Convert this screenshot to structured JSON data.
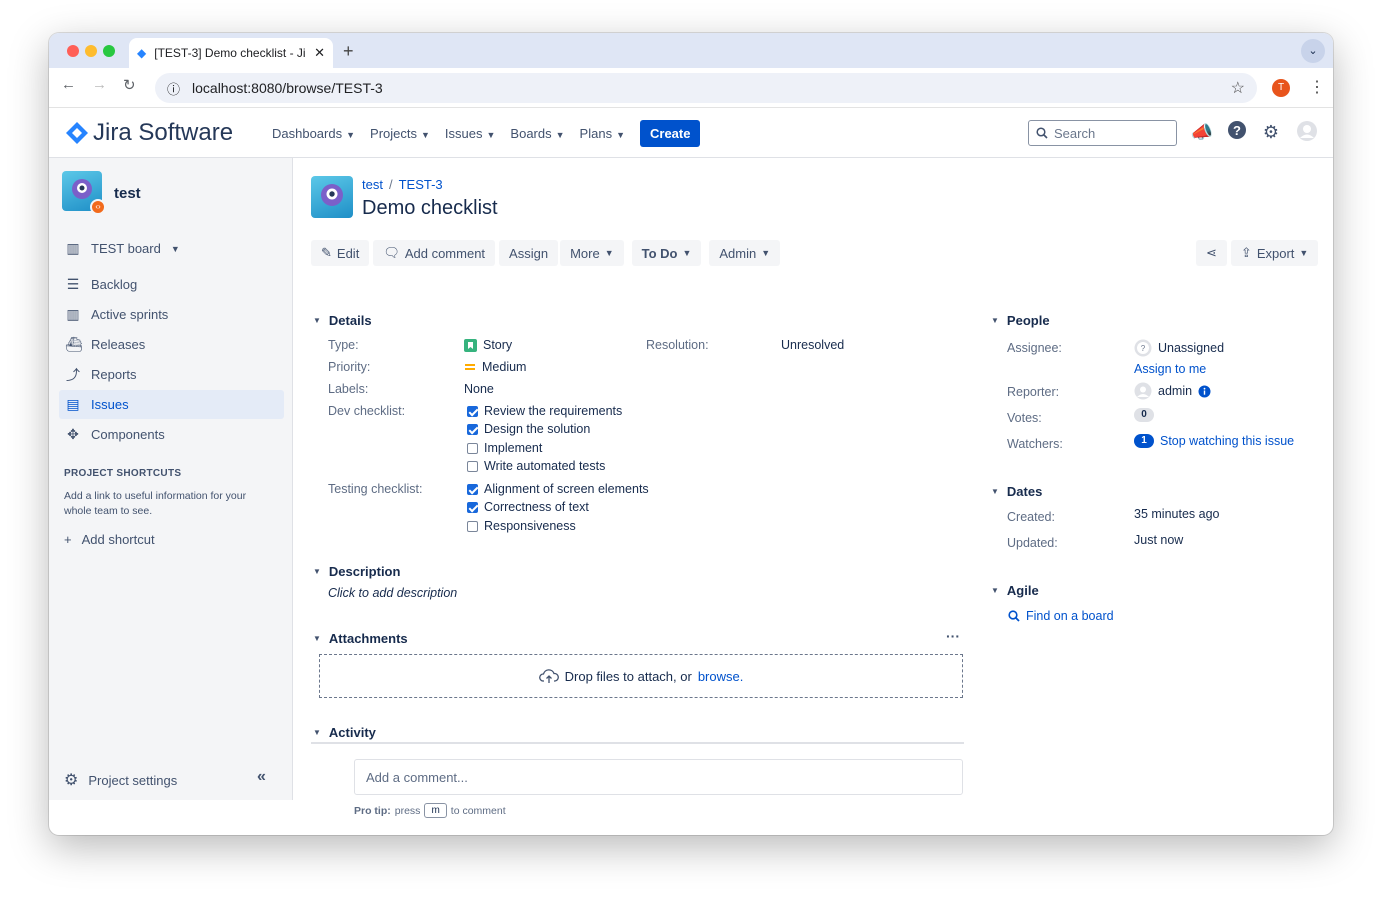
{
  "browser": {
    "tab_title": "[TEST-3] Demo checklist - Ji",
    "url": "localhost:8080/browse/TEST-3",
    "profile_initial": "T"
  },
  "header": {
    "logo_text": "Jira Software",
    "nav": [
      "Dashboards",
      "Projects",
      "Issues",
      "Boards",
      "Plans"
    ],
    "create_label": "Create",
    "search_placeholder": "Search"
  },
  "sidebar": {
    "project_name": "test",
    "board_label": "TEST board",
    "items": [
      {
        "label": "Backlog",
        "icon": "backlog-icon"
      },
      {
        "label": "Active sprints",
        "icon": "board-icon"
      },
      {
        "label": "Releases",
        "icon": "ship-icon"
      },
      {
        "label": "Reports",
        "icon": "chart-icon"
      },
      {
        "label": "Issues",
        "icon": "issues-icon",
        "active": true
      },
      {
        "label": "Components",
        "icon": "puzzle-icon"
      }
    ],
    "shortcuts_heading": "PROJECT SHORTCUTS",
    "shortcuts_text": "Add a link to useful information for your whole team to see.",
    "add_shortcut": "Add shortcut",
    "settings_label": "Project settings"
  },
  "issue": {
    "breadcrumb_project": "test",
    "breadcrumb_key": "TEST-3",
    "title": "Demo checklist",
    "ops": {
      "edit": "Edit",
      "comment": "Add comment",
      "assign": "Assign",
      "more": "More",
      "status": "To Do",
      "admin": "Admin",
      "export": "Export"
    },
    "details": {
      "heading": "Details",
      "type_label": "Type:",
      "type_value": "Story",
      "resolution_label": "Resolution:",
      "resolution_value": "Unresolved",
      "priority_label": "Priority:",
      "priority_value": "Medium",
      "labels_label": "Labels:",
      "labels_value": "None",
      "dev_label": "Dev checklist:",
      "dev_items": [
        {
          "text": "Review the requirements",
          "checked": true
        },
        {
          "text": "Design the solution",
          "checked": true
        },
        {
          "text": "Implement",
          "checked": false
        },
        {
          "text": "Write automated tests",
          "checked": false
        }
      ],
      "testing_label": "Testing checklist:",
      "testing_items": [
        {
          "text": "Alignment of screen elements",
          "checked": true
        },
        {
          "text": "Correctness of text",
          "checked": true
        },
        {
          "text": "Responsiveness",
          "checked": false
        }
      ]
    },
    "description": {
      "heading": "Description",
      "placeholder": "Click to add description"
    },
    "attachments": {
      "heading": "Attachments",
      "drop_text": "Drop files to attach, or",
      "browse": "browse."
    },
    "activity": {
      "heading": "Activity",
      "comment_placeholder": "Add a comment...",
      "protip_bold": "Pro tip:",
      "protip_pre": "press",
      "protip_key": "m",
      "protip_post": "to comment"
    }
  },
  "people": {
    "heading": "People",
    "assignee_label": "Assignee:",
    "assignee_value": "Unassigned",
    "assign_to_me": "Assign to me",
    "reporter_label": "Reporter:",
    "reporter_value": "admin",
    "votes_label": "Votes:",
    "votes_value": "0",
    "watchers_label": "Watchers:",
    "watchers_count": "1",
    "watchers_link": "Stop watching this issue"
  },
  "dates": {
    "heading": "Dates",
    "created_label": "Created:",
    "created_value": "35 minutes ago",
    "updated_label": "Updated:",
    "updated_value": "Just now"
  },
  "agile": {
    "heading": "Agile",
    "find_board": "Find on a board"
  },
  "colors": {
    "accent": "#0052cc",
    "story": "#36b37e",
    "priority": "#ffab00"
  }
}
